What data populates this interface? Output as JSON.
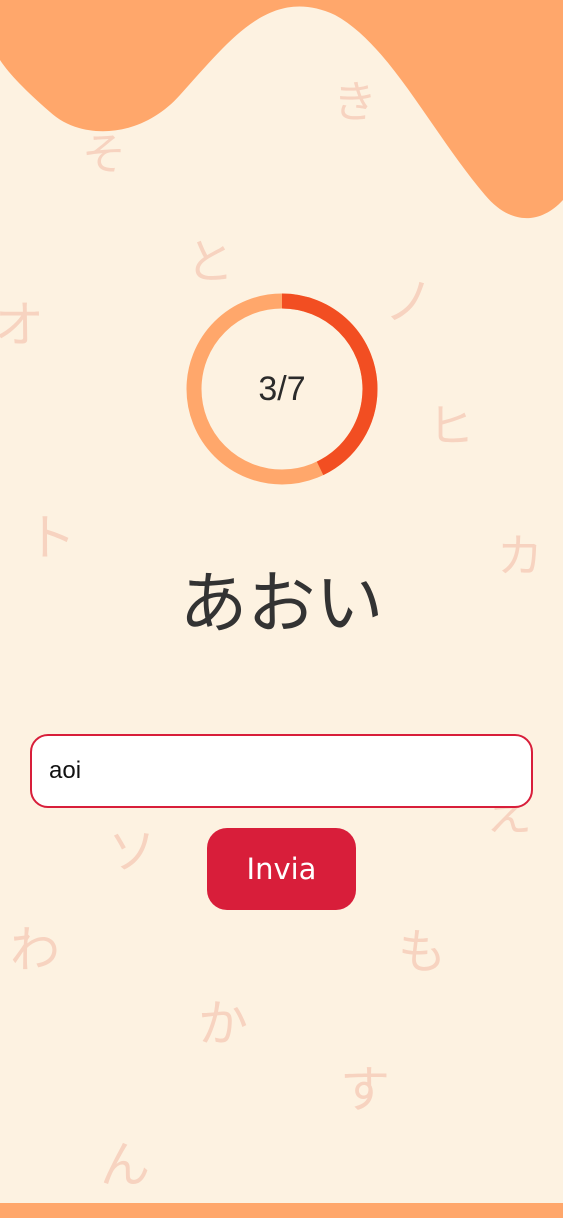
{
  "colors": {
    "background": "#fdf2e1",
    "accent_orange": "#ffa76b",
    "progress_done": "#f24e22",
    "primary_red": "#d81e3a"
  },
  "background_kana": [
    "そ",
    "き",
    "と",
    "ノ",
    "オ",
    "ヒ",
    "ト",
    "カ",
    "ソ",
    "え",
    "わ",
    "も",
    "か",
    "す",
    "ん"
  ],
  "progress": {
    "label": "3/7",
    "current": 3,
    "total": 7
  },
  "quiz": {
    "word": "あおい"
  },
  "answer_input": {
    "value": "aoi",
    "placeholder": ""
  },
  "submit_button": {
    "label": "Invia"
  }
}
